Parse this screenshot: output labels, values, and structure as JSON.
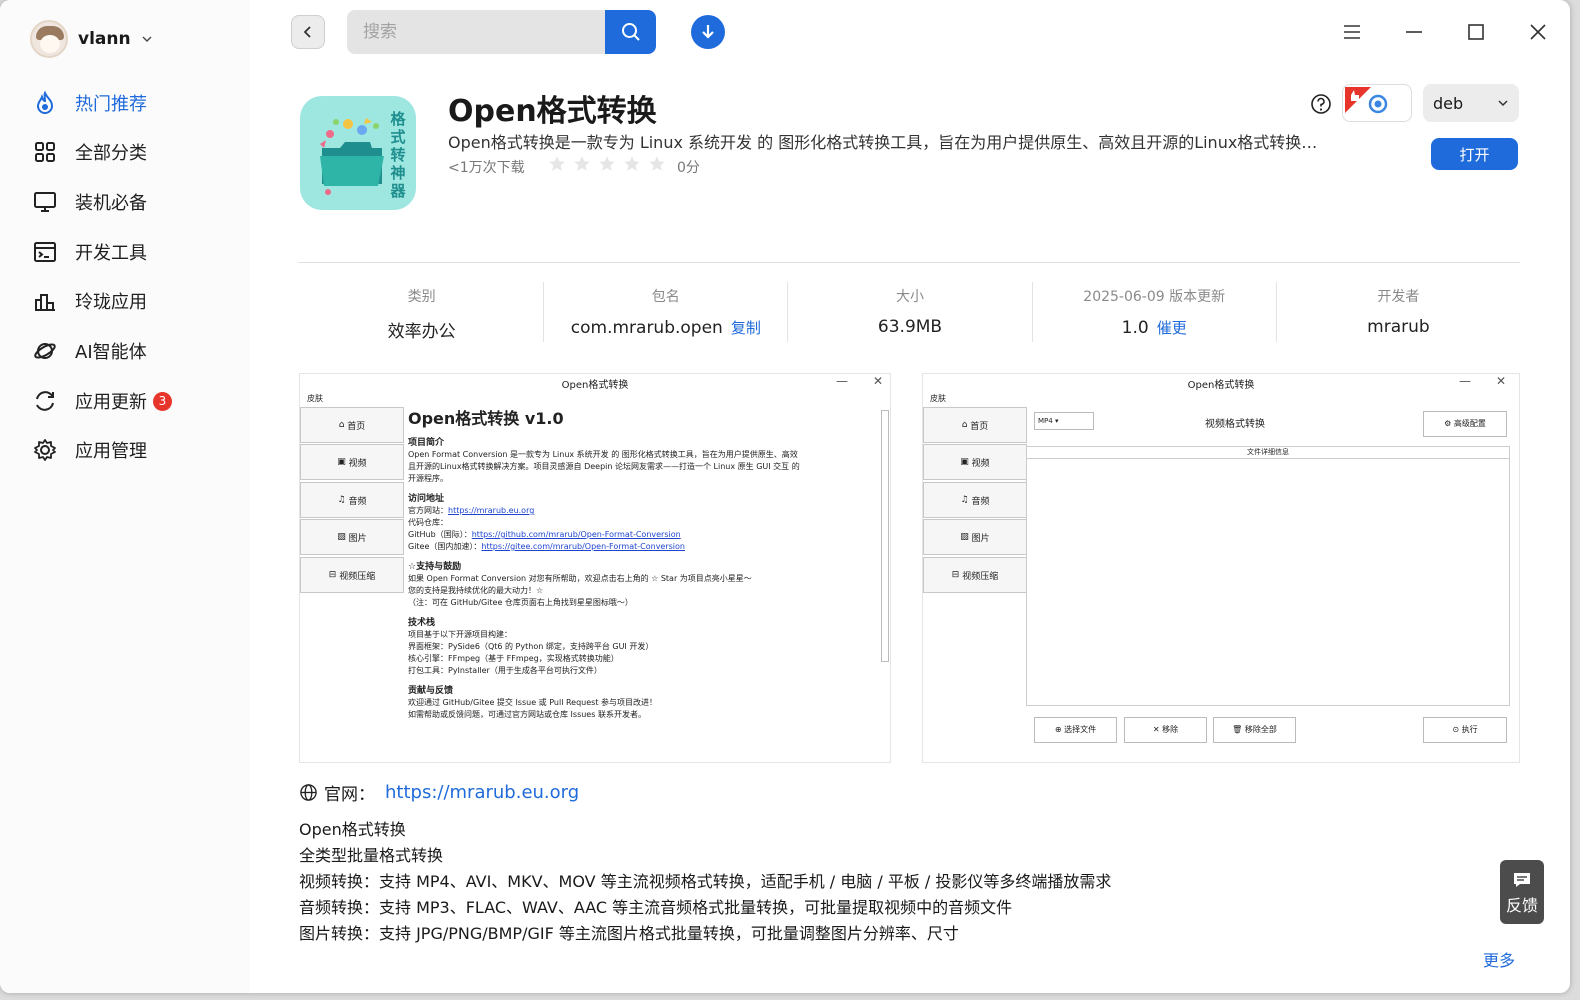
{
  "user": {
    "name": "vlann"
  },
  "sidebar": {
    "items": [
      {
        "label": "热门推荐",
        "icon": "flame-icon",
        "active": true
      },
      {
        "label": "全部分类",
        "icon": "grid-icon"
      },
      {
        "label": "装机必备",
        "icon": "monitor-icon"
      },
      {
        "label": "开发工具",
        "icon": "terminal-icon"
      },
      {
        "label": "玲珑应用",
        "icon": "chart-app-icon"
      },
      {
        "label": "AI智能体",
        "icon": "planet-icon"
      },
      {
        "label": "应用更新",
        "icon": "refresh-icon",
        "badge": "3"
      },
      {
        "label": "应用管理",
        "icon": "gear-icon"
      }
    ]
  },
  "search": {
    "placeholder": "搜索"
  },
  "app": {
    "title": "Open格式转换",
    "description": "Open格式转换是一款专为 Linux 系统开发 的 图形化格式转换工具，旨在为用户提供原生、高效且开源的Linux格式转换…",
    "downloads": "<1万次下载",
    "rating": 0,
    "score": "0分",
    "package_format": "deb",
    "open_label": "打开",
    "icon_text": "格式转神器"
  },
  "info": {
    "category_label": "类别",
    "category_value": "效率办公",
    "package_label": "包名",
    "package_value": "com.mrarub.open",
    "package_action": "复制",
    "size_label": "大小",
    "size_value": "63.9MB",
    "version_label": "2025-06-09 版本更新",
    "version_value": "1.0",
    "version_action": "催更",
    "developer_label": "开发者",
    "developer_value": "mrarub"
  },
  "screenshot1": {
    "window_title": "Open格式转换",
    "skin": "皮肤",
    "nav": [
      "首页",
      "视频",
      "音频",
      "图片",
      "视频压缩"
    ],
    "heading": "Open格式转换 v1.0",
    "sections": [
      {
        "title": "项目简介",
        "lines": [
          "Open Format Conversion 是一款专为 Linux 系统开发 的 图形化格式转换工具，旨在为用户提供原生、高效",
          "且开源的Linux格式转换解决方案。项目灵感源自 Deepin 论坛网友需求——打造一个 Linux 原生 GUI 交互 的",
          "开源程序。"
        ]
      },
      {
        "title": "访问地址",
        "lines": [
          "官方网站：",
          "代码仓库：",
          "GitHub（国际）：",
          "Gitee（国内加速）："
        ]
      },
      {
        "title": "☆支持与鼓励",
        "lines": [
          "如果 Open Format Conversion 对您有所帮助，欢迎点击右上角的 ☆ Star 为项目点亮小星星～",
          "您的支持是我持续优化的最大动力！☆",
          "（注：可在 GitHub/Gitee 仓库页面右上角找到星星图标哦～）"
        ]
      },
      {
        "title": "技术栈",
        "lines": [
          "项目基于以下开源项目构建：",
          "界面框架：PySide6（Qt6 的 Python 绑定，支持跨平台 GUI 开发）",
          "核心引擎：FFmpeg（基于 FFmpeg，实现格式转换功能）",
          "打包工具：PyInstaller（用于生成各平台可执行文件）"
        ]
      },
      {
        "title": "贡献与反馈",
        "lines": [
          "欢迎通过 GitHub/Gitee 提交 Issue 或 Pull Request 参与项目改进！",
          "如需帮助或反馈问题，可通过官方网站或仓库 Issues 联系开发者。"
        ]
      }
    ],
    "links": {
      "site": "https://mrarub.eu.org",
      "github": "https://github.com/mrarub/Open-Format-Conversion",
      "gitee": "https://gitee.com/mrarub/Open-Format-Conversion"
    }
  },
  "screenshot2": {
    "window_title": "Open格式转换",
    "skin": "皮肤",
    "nav": [
      "首页",
      "视频",
      "音频",
      "图片",
      "视频压缩"
    ],
    "format": "MP4",
    "heading": "视频格式转换",
    "advanced": "高级配置",
    "panel_header": "文件详细信息",
    "buttons": [
      "选择文件",
      "移除",
      "移除全部",
      "执行"
    ]
  },
  "website": {
    "label": "官网：",
    "url": "https://mrarub.eu.org"
  },
  "description_lines": [
    "Open格式转换",
    "全类型批量格式转换",
    "视频转换：支持 MP4、AVI、MKV、MOV 等主流视频格式转换，适配手机 / 电脑 / 平板 / 投影仪等多终端播放需求",
    "音频转换：支持 MP3、FLAC、WAV、AAC 等主流音频格式批量转换，可批量提取视频中的音频文件",
    "图片转换：支持 JPG/PNG/BMP/GIF 等主流图片格式批量转换，可批量调整图片分辨率、尺寸"
  ],
  "more": "更多",
  "feedback": "反馈",
  "colors": {
    "accent": "#1f6bdb",
    "badge": "#e8352b",
    "icon_bg": "#9ee6e0"
  }
}
